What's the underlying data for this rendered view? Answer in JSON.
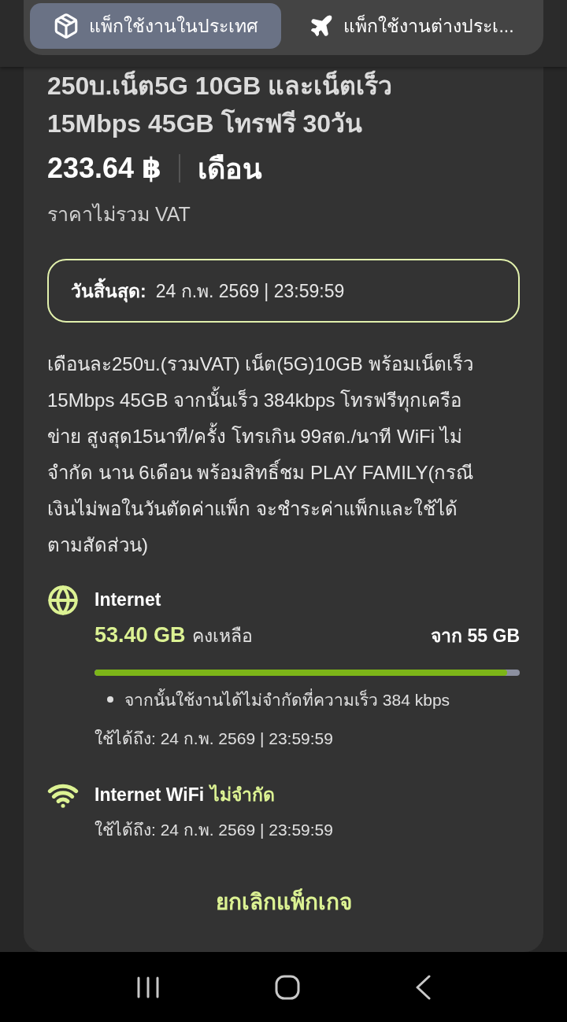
{
  "tabs": [
    {
      "label": "แพ็กใช้งานในประเทศ",
      "selected": true
    },
    {
      "label": "แพ็กใช้งานต่างประเ...",
      "selected": false
    }
  ],
  "package": {
    "title": "250บ.เน็ต5G 10GB และเน็ตเร็ว 15Mbps 45GB โทรฟรี 30วัน",
    "price": "233.64 ฿",
    "period": "เดือน",
    "price_note": "ราคาไม่รวม VAT"
  },
  "expiry": {
    "label": "วันสิ้นสุด:",
    "value": "24 ก.พ. 2569 | 23:59:59"
  },
  "description": "เดือนละ250บ.(รวมVAT) เน็ต(5G)10GB พร้อมเน็ตเร็ว 15Mbps 45GB จากนั้นเร็ว 384kbps โทรฟรีทุกเครือข่าย สูงสุด15นาที/ครั้ง โทรเกิน 99สต./นาที WiFi ไม่จำกัด นาน 6เดือน พร้อมสิทธิ์ชม PLAY FAMILY(กรณีเงินไม่พอในวันตัดค่าแพ็ก จะชำระค่าแพ็กและใช้ได้ตามสัดส่วน)",
  "allowances": [
    {
      "kind": "data",
      "name": "Internet",
      "remaining": "53.40 GB",
      "remaining_label": "คงเหลือ",
      "total": "จาก 55 GB",
      "level": 0.97,
      "notes": [
        "จากนั้นใช้งานได้ไม่จำกัดที่ความเร็ว 384 kbps"
      ],
      "valid_until": "ใช้ได้ถึง: 24 ก.พ. 2569 | 23:59:59"
    },
    {
      "kind": "wifi",
      "name": "Internet WiFi",
      "highlight": "ไม่จำกัด",
      "valid_until": "ใช้ได้ถึง: 24 ก.พ. 2569 | 23:59:59"
    }
  ],
  "cancel_button": "ยกเลิกแพ็กเกจ"
}
